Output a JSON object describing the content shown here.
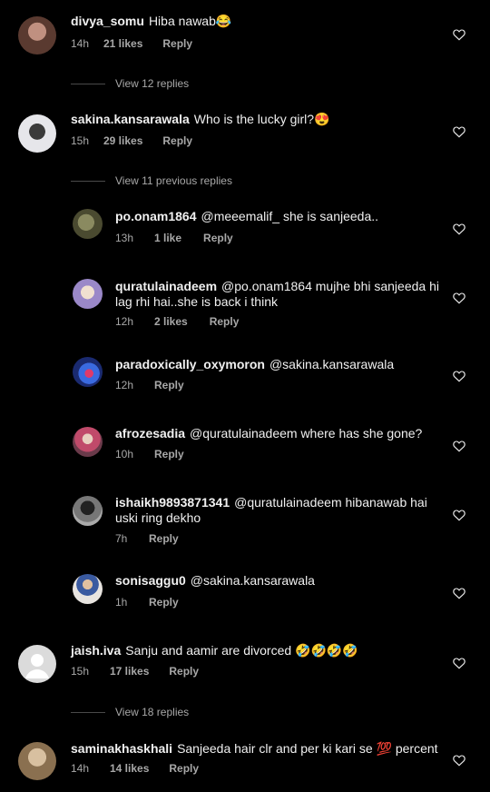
{
  "comments": [
    {
      "user": "divya_somu",
      "text": "Hiba nawab😂",
      "time": "14h",
      "likes": "21 likes",
      "reply": "Reply",
      "avatar_color": "#8a6a5a"
    },
    {
      "user": "sakina.kansarawala",
      "text": "Who is the lucky girl?😍",
      "time": "15h",
      "likes": "29 likes",
      "reply": "Reply",
      "avatar_color": "#d8d8dc"
    }
  ],
  "view_replies_1": "View 12 replies",
  "view_previous": "View 11 previous replies",
  "replies": [
    {
      "user": "po.onam1864",
      "text": "@meeemalif_ she is sanjeeda..",
      "time": "13h",
      "likes": "1 like",
      "reply": "Reply",
      "avatar_color": "#6b6a4a"
    },
    {
      "user": "quratulainadeem",
      "text": "@po.onam1864 mujhe bhi sanjeeda hi lag rhi hai..she is back i think",
      "line1": "@po.onam1864 mujhe bhi sanjeeda hi",
      "line2": "lag rhi hai..she is back i think",
      "time": "12h",
      "likes": "2 likes",
      "reply": "Reply",
      "avatar_color": "#c9c0e0"
    },
    {
      "user": "paradoxically_oxymoron",
      "text": "@sakina.kansarawala",
      "time": "12h",
      "likes": "",
      "reply": "Reply",
      "avatar_color": "#2a4aa8"
    },
    {
      "user": "afrozesadia",
      "text": "@quratulainadeem where has she gone?",
      "time": "10h",
      "likes": "",
      "reply": "Reply",
      "avatar_color": "#c85a6a"
    },
    {
      "user": "ishaikh9893871341",
      "text": "@quratulainadeem hibanawab hai uski ring dekho",
      "line1": "@quratulainadeem hibanawab hai",
      "line2": "uski ring dekho",
      "time": "7h",
      "likes": "",
      "reply": "Reply",
      "avatar_color": "#5a5a5a"
    },
    {
      "user": "sonisaggu0",
      "text": "@sakina.kansarawala",
      "time": "1h",
      "likes": "",
      "reply": "Reply",
      "avatar_color": "#d0c8c0"
    }
  ],
  "comment3": {
    "user": "jaish.iva",
    "text": "Sanju and aamir are divorced 🤣🤣🤣🤣",
    "time": "15h",
    "likes": "17 likes",
    "reply": "Reply"
  },
  "view_replies_2": "View 18 replies",
  "comment4": {
    "user": "saminakhaskhali",
    "text": "Sanjeeda hair clr and per ki kari se 💯 percent",
    "time": "14h",
    "likes": "14 likes",
    "reply": "Reply",
    "avatar_color": "#b8a080"
  }
}
